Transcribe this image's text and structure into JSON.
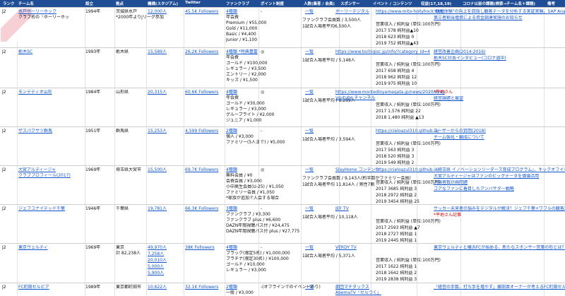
{
  "header": [
    "ランク",
    "チーム名",
    "設立",
    "拠点",
    "機構(スタジアム)",
    "Twitter",
    "ファンクラブ",
    "ポイント制度",
    "人数(集客 / 会員)",
    "スポンサー",
    "イベント / コンテンツ",
    "収益(17,18,19)",
    "コロナ以前の課題(検索→チーム名＋課題)",
    "備考"
  ],
  "teams": [
    {
      "rank": "J2",
      "name": "水戸ホーリーホック",
      "name2": "クラブ名の「ホーリーホッ",
      "year": "1994年",
      "city": "茨城県水戸",
      "city2": "*2000年よりJリーグ参加",
      "stadium": [
        "12,000人"
      ],
      "twitter": "45.5K Followers",
      "fc_title": "4種類",
      "fc_list": [
        "年会費",
        "Premium / ¥55,000",
        "Gold / ¥11,000",
        "Basic / ¥4,400",
        "Junior / ¥1,100"
      ],
      "point": "-",
      "people": [
        "ファンクラブ会員数 / 3,500人",
        "1試合入場者平均6,500人"
      ],
      "sponsor": "一覧",
      "event": "ホーリーデジタル",
      "revenue_link": "https://www.mito-hollyhock.net/",
      "revenue": [
        "営業収入 / 純利益 (単位:100万円)",
        "2017  578  純利益▲10",
        "2018  623  純利益 0",
        "2019  752  純利益▲43"
      ],
      "issue": [
        "\"観戦体験\"の向上を目指し観客データを分析する実証実験。SAP Analyt",
        "第三者割当増資による資金調達実施のお知らせ"
      ]
    },
    {
      "rank": "J2",
      "name": "栃木SC",
      "year": "1993年",
      "city": "栃木県",
      "stadium": [
        "15,589人"
      ],
      "twitter": "26.2K Followers",
      "fc_title": "4種類 *特典豊富",
      "fc_list": [
        "年会費",
        "ゴールド / ¥100,000",
        "レギュラー / ¥3,500",
        "エントリー / ¥2,000",
        "キッズ / ¥1,500"
      ],
      "point": "◎",
      "people": [
        "1試合入場者平均 / 5,148人"
      ],
      "sponsor": "一覧",
      "event": "https://www.tochigisc.jp/info/?category_id=4",
      "revenue": [
        "営業収入 / 純利益 (単位:100万円)",
        "2017  658  純利益 4",
        "2018  962  純利益 12",
        "2019  975  純利益 10"
      ],
      "issue": [
        "経営改善企画(2014-2016)",
        "栃木SC社長インタビュー(コロナ過中)"
      ]
    },
    {
      "rank": "J2",
      "name": "モンテディオ山形",
      "year": "1984年",
      "city": "山形県",
      "stadium": [
        "20,315人"
      ],
      "twitter": "60.6K Followers",
      "fc_title": "4種類",
      "fc_list": [
        "年会費",
        "ゴールド / ¥30,000",
        "レギュラー / ¥3,000",
        "グループライト / ¥2,000",
        "ジュニア / ¥1,000"
      ],
      "point": "◎",
      "people": [
        "1試合入場者平均 / 8,289人"
      ],
      "sponsor": "一覧",
      "event": "https://www.montedioyamagata.jp/news/2020/event/",
      "event2": "youtube チャンネル",
      "revenue": [
        "営業収入 / 純利益 (単位:100万円)",
        "2017  1,576  純利益 22",
        "2018  1,480  純利益 ▲13"
      ],
      "issue": [
        "*平地さん",
        "経営課題と展望"
      ]
    },
    {
      "rank": "J2",
      "name": "ザスパクサツ群馬",
      "year": "1951年",
      "city": "群馬県",
      "stadium": [
        "15,253人"
      ],
      "twitter": "4,599 Followers",
      "fc_title": "2種類",
      "fc_list": [
        "個人 / ¥3,000",
        "ファミリー(5人まで) / ¥5,000"
      ],
      "point": "-",
      "people": [
        "1試合入場者平均 / 3,594人"
      ],
      "sponsor": "一覧",
      "event": "",
      "revenue_link": "https://cieloazul310.github.io/",
      "revenue": [
        "営業収入 / 純利益 (単位:100万円)",
        "2017  563  純利益 3",
        "2018  520  純利益 3",
        "2019  549  純利益 2"
      ],
      "issue": [
        "ユーザーからの質問(2018)",
        "チーム強化・編成について"
      ]
    },
    {
      "rank": "J2",
      "name": "大宮アルディージャ",
      "name2": "クラブプロフィール(2017)",
      "year": "1969年",
      "city": "埼玉県大宮市",
      "stadium": [
        "15,500人"
      ],
      "twitter": "69.7K Followers",
      "fc_title": "4種類",
      "fc_list": [
        "無料会員 / ¥0",
        "会費会員 / ¥3,000",
        "小中高生会員(U-25) / ¥1,050",
        "ファミリー会員 / ¥1,050",
        "*家族が追加で入会する場合"
      ],
      "point": "◎",
      "people": [
        "ファンクラブ会員数 / 9,143人(約半数がファミリー会員)",
        "1試合入場者平均 11,814人 / 男性7割"
      ],
      "sponsor": "一覧",
      "event": "SlayHome コンテンツ",
      "revenue_link": "https://cieloazul310.github.io/",
      "revenue": [
        "営業収入 / 純利益 (単位:100万円)",
        "2017  3685  純利益 3",
        "2018  2972  純利益 2",
        "2019  3454  純利益 25"
      ],
      "issue": [
        "『埼玉県 イノベーションリーダーズ育成プログラム』、キックオフイベ",
        "大宮アルディージャはファンのビッグデータを価値活用",
        "入場者数計画問題",
        "コアなファンに着目したアンバサダー戦略"
      ]
    },
    {
      "rank": "J2",
      "name": "ジェフユナイテッド千葉",
      "year": "1946年",
      "city": "千葉県",
      "stadium": [
        "19,781人"
      ],
      "twitter": "66.3K Followers",
      "fc_title": "3種類",
      "fc_list": [
        "ファンクラブ / ¥3,300",
        "ファンクラブ plus / ¥6,600",
        "DAZN年間視聴パス付 / ¥24,475",
        "DAZN年間視聴パス付 plus / ¥27,775"
      ],
      "point": "-",
      "people": [
        "1試合入場者平均 / 10,118人"
      ],
      "sponsor": "一覧",
      "event": "JEF TV",
      "revenue": [
        "営業収入 / 純利益 (単位:100万円)",
        "2017  2593  純利益 ▲7",
        "2018  2727  純利益 1",
        "2019  2445  純利益 1"
      ],
      "issue": [
        "サッカー未来者の悩みをデジタルが解決！ジェフ千葉+ワフルの観客満足",
        "*平地さん記事"
      ]
    },
    {
      "rank": "J2",
      "name": "東京ヴェルディ",
      "year": "1969年",
      "city": "東京",
      "city2": "計 82,238人",
      "stadium": [
        "49,970人",
        "7,258人",
        "20,010人",
        "5,000人",
        "5,900人"
      ],
      "twitter": "38K Followers",
      "fc_title": "4種類",
      "fc_list": [
        "ブラック(限定5名) / ¥1,000,000",
        "プラチナ(限定30名) / ¥100,000",
        "ゴールド / ¥10,000",
        "レギュラー / ¥3,000"
      ],
      "point": "-",
      "people": [
        "1試合入場者平均 / 5,371人"
      ],
      "sponsor": "一覧",
      "event": "VERDY TV",
      "revenue": [
        "営業収入 / 純利益 (単位:100万円)",
        "2017  1622  純利益 1",
        "2018  1642  純利益 2",
        "2019  2838  純利益 3"
      ],
      "issue": [
        "東京ヴェルディと横浜FCが始める、新たなスポンサー営業の形とは？"
      ]
    },
    {
      "rank": "J2",
      "name": "FC町田ゼルビア",
      "year": "1989年",
      "city": "東京都町田市",
      "stadium": [
        "10,622人"
      ],
      "twitter": "32.1K Followers",
      "fc_title": "2種類",
      "fc_list": [
        "一般 / ¥3,000"
      ],
      "point": "-(オフラインでのイベントあり)",
      "people": [],
      "sponsor": "一覧",
      "event": "劇団マチダックス",
      "event2": "AbemaTV「ゼルつく」",
      "revenue": [],
      "issue": [
        "「経営の手数、打ち手を増やす」藤田晋オーナーが考えるFC町田ゼルビ"
      ]
    }
  ]
}
